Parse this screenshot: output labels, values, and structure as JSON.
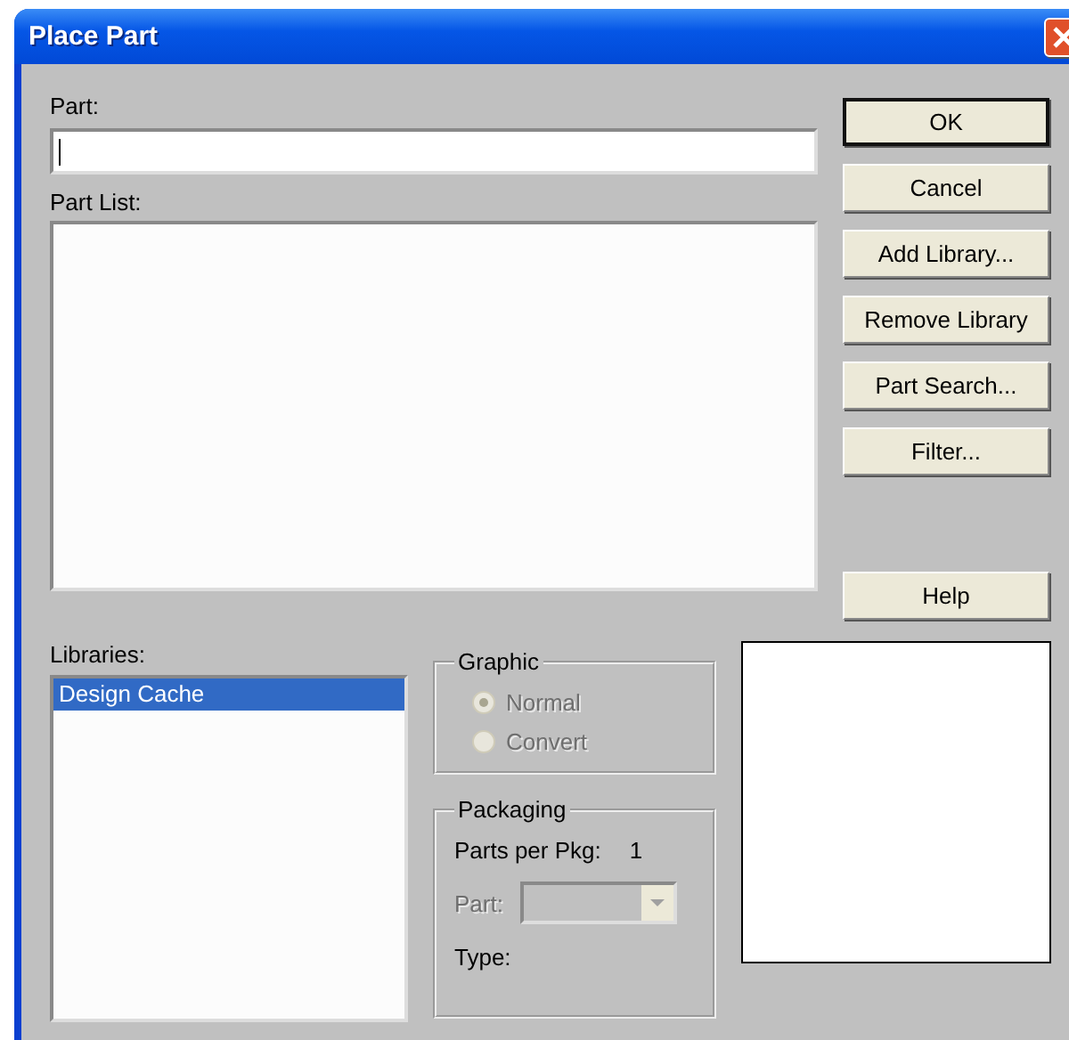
{
  "window": {
    "title": "Place Part"
  },
  "part_field": {
    "label": "Part:"
  },
  "part_list": {
    "label": "Part List:"
  },
  "buttons": [
    {
      "label": "OK",
      "default": true
    },
    {
      "label": "Cancel",
      "default": false
    },
    {
      "label": "Add Library...",
      "default": false
    },
    {
      "label": "Remove Library",
      "default": false
    },
    {
      "label": "Part Search...",
      "default": false
    },
    {
      "label": "Filter...",
      "default": false
    },
    {
      "label": "Help",
      "default": false
    }
  ],
  "libraries": {
    "label": "Libraries:",
    "items": [
      {
        "name": "Design Cache",
        "selected": true
      }
    ]
  },
  "graphic": {
    "title": "Graphic",
    "options": [
      {
        "label": "Normal",
        "selected": true,
        "disabled": true
      },
      {
        "label": "Convert",
        "selected": false,
        "disabled": true
      }
    ]
  },
  "packaging": {
    "title": "Packaging",
    "parts_per_pkg": {
      "label": "Parts per Pkg:",
      "value": "1"
    },
    "part": {
      "label": "Part:",
      "disabled": true
    },
    "type": {
      "label": "Type:"
    }
  }
}
